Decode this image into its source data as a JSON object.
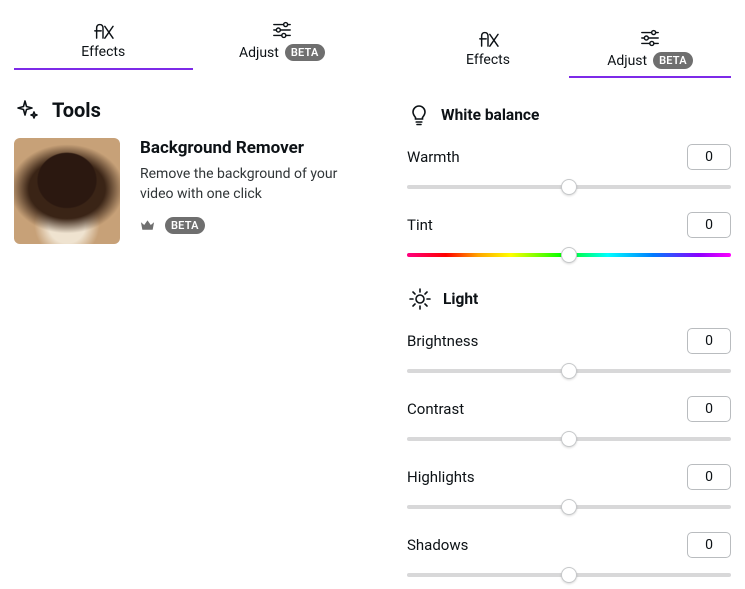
{
  "leftPanel": {
    "tabs": {
      "effects": {
        "label": "Effects"
      },
      "adjust": {
        "label": "Adjust",
        "badge": "BETA"
      }
    },
    "toolsHeader": "Tools",
    "tool": {
      "title": "Background Remover",
      "desc": "Remove the background of your video with one click",
      "badge": "BETA"
    }
  },
  "rightPanel": {
    "tabs": {
      "effects": {
        "label": "Effects"
      },
      "adjust": {
        "label": "Adjust",
        "badge": "BETA"
      }
    },
    "groups": {
      "whiteBalance": {
        "title": "White balance",
        "controls": {
          "warmth": {
            "label": "Warmth",
            "value": "0"
          },
          "tint": {
            "label": "Tint",
            "value": "0"
          }
        }
      },
      "light": {
        "title": "Light",
        "controls": {
          "brightness": {
            "label": "Brightness",
            "value": "0"
          },
          "contrast": {
            "label": "Contrast",
            "value": "0"
          },
          "highlights": {
            "label": "Highlights",
            "value": "0"
          },
          "shadows": {
            "label": "Shadows",
            "value": "0"
          }
        }
      }
    }
  }
}
